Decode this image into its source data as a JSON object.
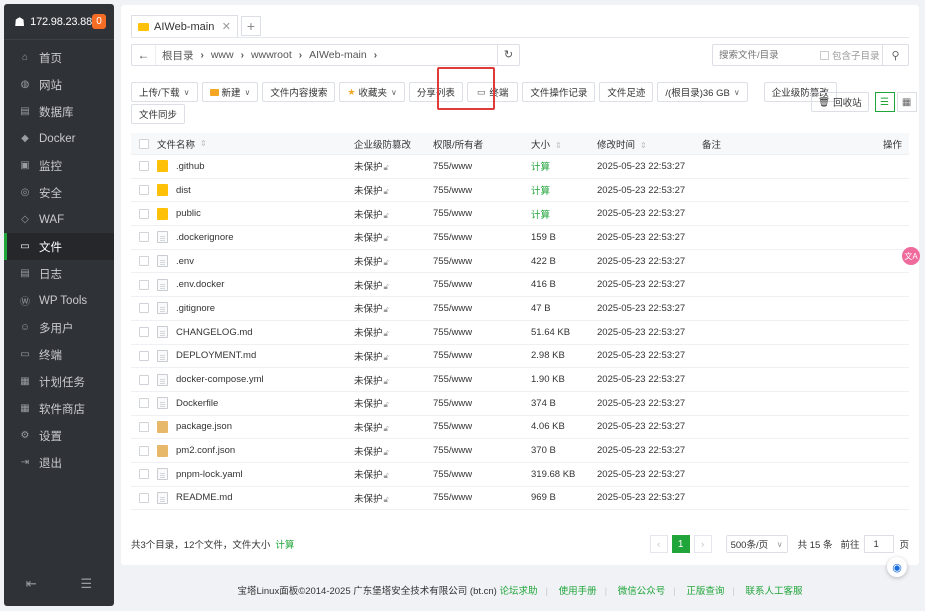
{
  "sidebar": {
    "ip": "172.98.23.88",
    "badge": "0",
    "items": [
      {
        "label": "首页",
        "icon": "home-icon",
        "glyph": "⌂"
      },
      {
        "label": "网站",
        "icon": "globe-icon",
        "glyph": "◍"
      },
      {
        "label": "数据库",
        "icon": "database-icon",
        "glyph": "▤"
      },
      {
        "label": "Docker",
        "icon": "docker-icon",
        "glyph": "◆"
      },
      {
        "label": "监控",
        "icon": "monitor-icon",
        "glyph": "▣"
      },
      {
        "label": "安全",
        "icon": "security-icon",
        "glyph": "◎"
      },
      {
        "label": "WAF",
        "icon": "shield-icon",
        "glyph": "◇"
      },
      {
        "label": "文件",
        "icon": "folder-icon",
        "glyph": "▭"
      },
      {
        "label": "日志",
        "icon": "log-icon",
        "glyph": "▤"
      },
      {
        "label": "WP Tools",
        "icon": "wordpress-icon",
        "glyph": "Ⓦ"
      },
      {
        "label": "多用户",
        "icon": "users-icon",
        "glyph": "☺"
      },
      {
        "label": "终端",
        "icon": "terminal-icon",
        "glyph": "▭"
      },
      {
        "label": "计划任务",
        "icon": "calendar-icon",
        "glyph": "▦"
      },
      {
        "label": "软件商店",
        "icon": "grid-icon",
        "glyph": "▦"
      },
      {
        "label": "设置",
        "icon": "gear-icon",
        "glyph": "⚙"
      },
      {
        "label": "退出",
        "icon": "logout-icon",
        "glyph": "⇥"
      }
    ],
    "active_index": 7
  },
  "tabs": [
    {
      "label": "AIWeb-main"
    }
  ],
  "address": {
    "crumbs": [
      "根目录",
      "www",
      "wwwroot",
      "AIWeb-main"
    ]
  },
  "search": {
    "placeholder": "搜索文件/目录",
    "subdir_label": "包含子目录"
  },
  "toolbar": {
    "upload": "上传/下载",
    "new": "新建",
    "content_search": "文件内容搜索",
    "favorites": "收藏夹",
    "share_list": "分享列表",
    "terminal": "终端",
    "op_log": "文件操作记录",
    "footprint": "文件足迹",
    "disk": "/(根目录)36 GB",
    "tamper": "企业级防篡改",
    "sync": "文件同步",
    "recycle": "回收站"
  },
  "table": {
    "headers": {
      "name": "文件名称",
      "protect": "企业级防篡改",
      "perm": "权限/所有者",
      "size": "大小",
      "mtime": "修改时间",
      "note": "备注",
      "op": "操作"
    },
    "rows": [
      {
        "name": ".github",
        "type": "folder",
        "protect": "未保护",
        "perm": "755/www",
        "size": "计算",
        "mtime": "2025-05-23 22:53:27"
      },
      {
        "name": "dist",
        "type": "folder",
        "protect": "未保护",
        "perm": "755/www",
        "size": "计算",
        "mtime": "2025-05-23 22:53:27"
      },
      {
        "name": "public",
        "type": "folder",
        "protect": "未保护",
        "perm": "755/www",
        "size": "计算",
        "mtime": "2025-05-23 22:53:27"
      },
      {
        "name": ".dockerignore",
        "type": "file",
        "protect": "未保护",
        "perm": "755/www",
        "size": "159 B",
        "mtime": "2025-05-23 22:53:27"
      },
      {
        "name": ".env",
        "type": "file",
        "protect": "未保护",
        "perm": "755/www",
        "size": "422 B",
        "mtime": "2025-05-23 22:53:27"
      },
      {
        "name": ".env.docker",
        "type": "file",
        "protect": "未保护",
        "perm": "755/www",
        "size": "416 B",
        "mtime": "2025-05-23 22:53:27"
      },
      {
        "name": ".gitignore",
        "type": "file",
        "protect": "未保护",
        "perm": "755/www",
        "size": "47 B",
        "mtime": "2025-05-23 22:53:27"
      },
      {
        "name": "CHANGELOG.md",
        "type": "file",
        "protect": "未保护",
        "perm": "755/www",
        "size": "51.64 KB",
        "mtime": "2025-05-23 22:53:27"
      },
      {
        "name": "DEPLOYMENT.md",
        "type": "file",
        "protect": "未保护",
        "perm": "755/www",
        "size": "2.98 KB",
        "mtime": "2025-05-23 22:53:27"
      },
      {
        "name": "docker-compose.yml",
        "type": "file",
        "protect": "未保护",
        "perm": "755/www",
        "size": "1.90 KB",
        "mtime": "2025-05-23 22:53:27"
      },
      {
        "name": "Dockerfile",
        "type": "file",
        "protect": "未保护",
        "perm": "755/www",
        "size": "374 B",
        "mtime": "2025-05-23 22:53:27"
      },
      {
        "name": "package.json",
        "type": "pkg",
        "protect": "未保护",
        "perm": "755/www",
        "size": "4.06 KB",
        "mtime": "2025-05-23 22:53:27"
      },
      {
        "name": "pm2.conf.json",
        "type": "pkg",
        "protect": "未保护",
        "perm": "755/www",
        "size": "370 B",
        "mtime": "2025-05-23 22:53:27"
      },
      {
        "name": "pnpm-lock.yaml",
        "type": "file",
        "protect": "未保护",
        "perm": "755/www",
        "size": "319.68 KB",
        "mtime": "2025-05-23 22:53:27"
      },
      {
        "name": "README.md",
        "type": "file",
        "protect": "未保护",
        "perm": "755/www",
        "size": "969 B",
        "mtime": "2025-05-23 22:53:27"
      }
    ]
  },
  "footer": {
    "summary": "共3个目录，12个文件，文件大小",
    "calc": "计算",
    "page": "1",
    "page_size": "500条/页",
    "total": "共 15 条",
    "goto": "前往",
    "goto_value": "1",
    "page_unit": "页"
  },
  "copyright": {
    "text": "宝塔Linux面板©2014-2025 广东堡塔安全技术有限公司 (bt.cn)",
    "links": [
      "论坛求助",
      "使用手册",
      "微信公众号",
      "正版查询",
      "联系人工客服"
    ]
  },
  "colors": {
    "accent": "#20a53a",
    "sidebar_bg": "#2f3237",
    "highlight": "#e03b3b",
    "folder": "#ffc107"
  }
}
